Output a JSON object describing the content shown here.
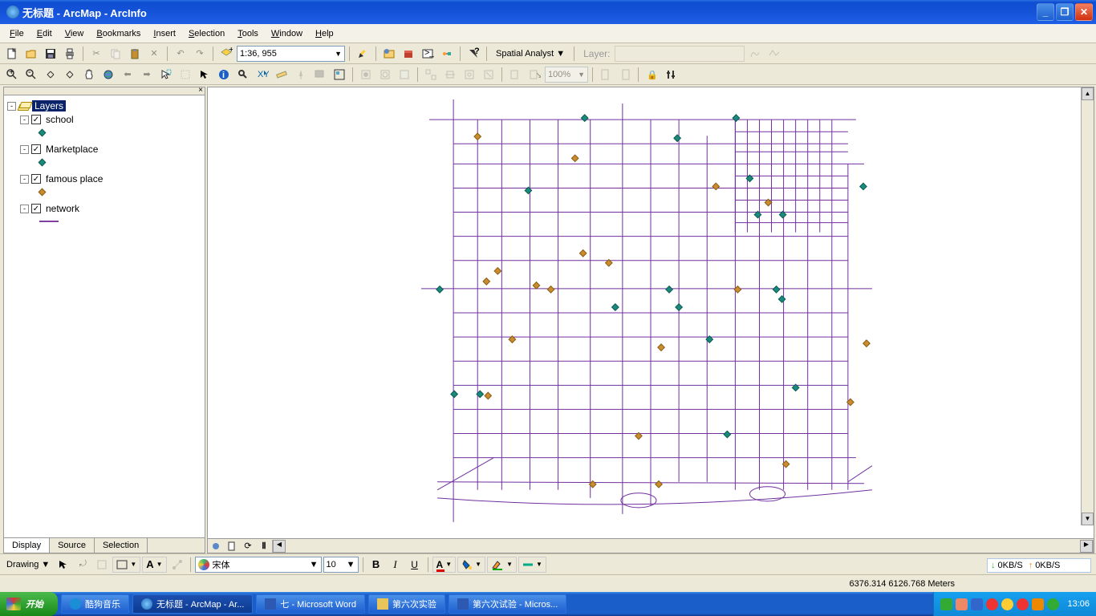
{
  "title": "无标题 - ArcMap - ArcInfo",
  "menus": [
    "File",
    "Edit",
    "View",
    "Bookmarks",
    "Insert",
    "Selection",
    "Tools",
    "Window",
    "Help"
  ],
  "scale": "1:36, 955",
  "spatial_analyst_label": "Spatial Analyst",
  "layer_label": "Layer:",
  "zoom_pct": "100%",
  "toc": {
    "root": "Layers",
    "items": [
      {
        "label": "school",
        "checked": true,
        "symbol": "teal-diamond"
      },
      {
        "label": "Marketplace",
        "checked": true,
        "symbol": "teal-diamond"
      },
      {
        "label": "famous place",
        "checked": true,
        "symbol": "orange-diamond"
      },
      {
        "label": "network",
        "checked": true,
        "symbol": "purple-line"
      }
    ],
    "tabs": [
      "Display",
      "Source",
      "Selection"
    ]
  },
  "draw_label": "Drawing",
  "font_name": "宋体",
  "font_size": "10",
  "coords": "6376.314 6126.768 Meters",
  "net_speed_down": "0KB/S",
  "net_speed_up": "0KB/S",
  "taskbar": {
    "start": "开始",
    "items": [
      {
        "label": "酷狗音乐",
        "icon": "#1a8ed6"
      },
      {
        "label": "无标题 - ArcMap - Ar...",
        "icon": "#3a86c8",
        "active": true
      },
      {
        "label": "七 - Microsoft Word",
        "icon": "#2c5ab3"
      },
      {
        "label": "第六次实验",
        "icon": "#e8c55a"
      },
      {
        "label": "第六次试验 - Micros...",
        "icon": "#2c5ab3"
      }
    ],
    "clock": "13:06"
  },
  "colors": {
    "school": "#1a8a7e",
    "marketplace": "#1a8a7e",
    "famous": "#c98c2e",
    "network": "#7030a0"
  }
}
